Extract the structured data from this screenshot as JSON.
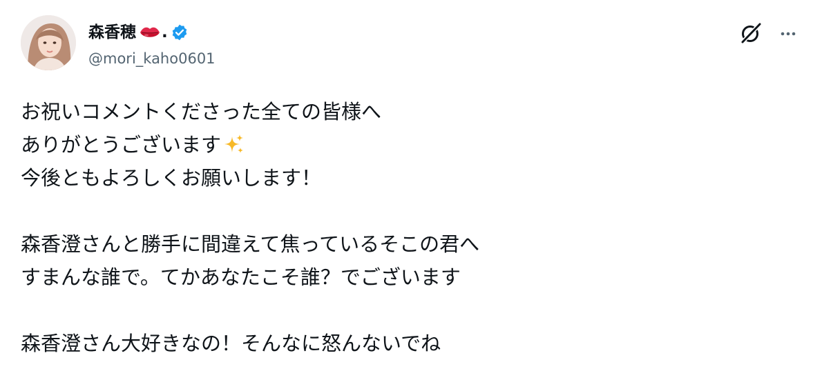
{
  "author": {
    "display_name": "森香穂",
    "name_suffix": ".",
    "handle": "@mori_kaho0601",
    "name_emoji": "lips-icon",
    "verified": true,
    "verified_color": "#1d9bf0"
  },
  "header_icons": {
    "grok": "grok-icon",
    "more": "more-icon"
  },
  "tweet": {
    "lines": [
      "お祝いコメントくださった全ての皆様へ",
      "ありがとうございます",
      "今後ともよろしくお願いします！",
      "",
      "森香澄さんと勝手に間違えて焦っているそこの君へ",
      "すまんな誰で。てかあなたこそ誰？でございます",
      "",
      "森香澄さん大好きなの！そんなに怒んないでね"
    ],
    "line_2_emoji": "sparkles-icon"
  },
  "colors": {
    "text": "#0f1419",
    "secondary_text": "#536471",
    "background": "#ffffff",
    "accent": "#1d9bf0"
  }
}
